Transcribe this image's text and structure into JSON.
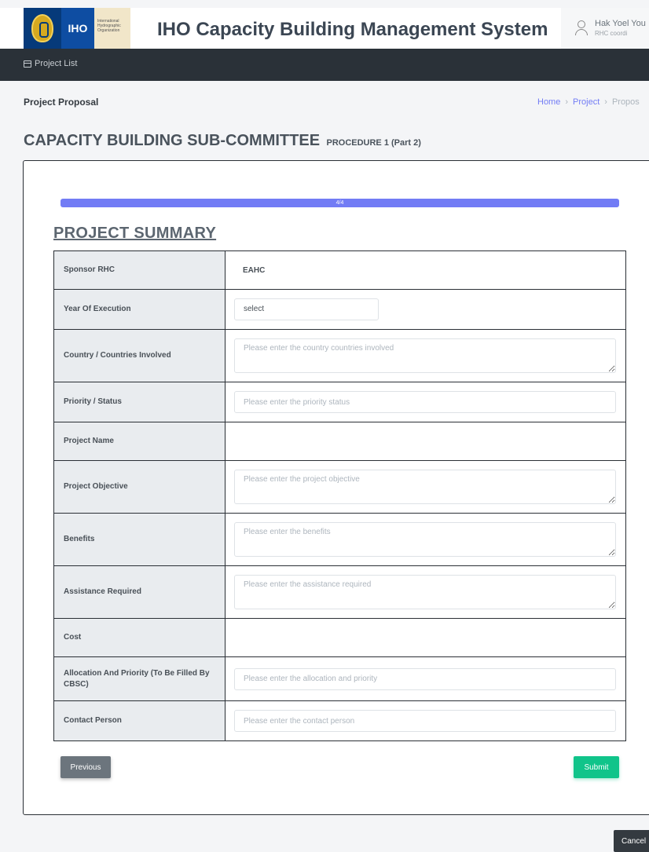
{
  "header": {
    "logo_text": "IHO",
    "logo_org": "International Hydrographic Organization",
    "title": "IHO Capacity Building Management System",
    "user_name": "Hak Yoel You",
    "user_role": "RHC coordi"
  },
  "navbar": {
    "items": [
      {
        "label": "Project List",
        "icon": "calendar-icon"
      }
    ]
  },
  "page": {
    "title": "Project Proposal",
    "breadcrumb": [
      "Home",
      "Project",
      "Propos"
    ],
    "heading": "CAPACITY BUILDING SUB-COMMITTEE",
    "subheading": "PROCEDURE 1 (Part 2)"
  },
  "progress": {
    "label": "4/4",
    "fraction": 1.0
  },
  "summary": {
    "title": "PROJECT SUMMARY",
    "rows": [
      {
        "label": "Sponsor RHC",
        "value": "EAHC"
      },
      {
        "label": "Year Of Execution",
        "value": "select"
      },
      {
        "label": "Country / Countries Involved",
        "placeholder": "Please enter the country countries involved"
      },
      {
        "label": "Priority / Status",
        "placeholder": "Please enter the priority status"
      },
      {
        "label": "Project Name",
        "value": ""
      },
      {
        "label": "Project Objective",
        "placeholder": "Please enter the project objective"
      },
      {
        "label": "Benefits",
        "placeholder": "Please enter the benefits"
      },
      {
        "label": "Assistance Required",
        "placeholder": "Please enter the assistance required"
      },
      {
        "label": "Cost",
        "value": ""
      },
      {
        "label": "Allocation And Priority (To Be Filled By CBSC)",
        "placeholder": "Please enter the allocation and priority"
      },
      {
        "label": "Contact Person",
        "placeholder": "Please enter the contact person"
      }
    ]
  },
  "buttons": {
    "previous": "Previous",
    "submit": "Submit",
    "cancel": "Cancel"
  },
  "colors": {
    "accent": "#727cf5",
    "navbar": "#2a3138",
    "submit": "#10c48a",
    "previous": "#6c757d"
  }
}
